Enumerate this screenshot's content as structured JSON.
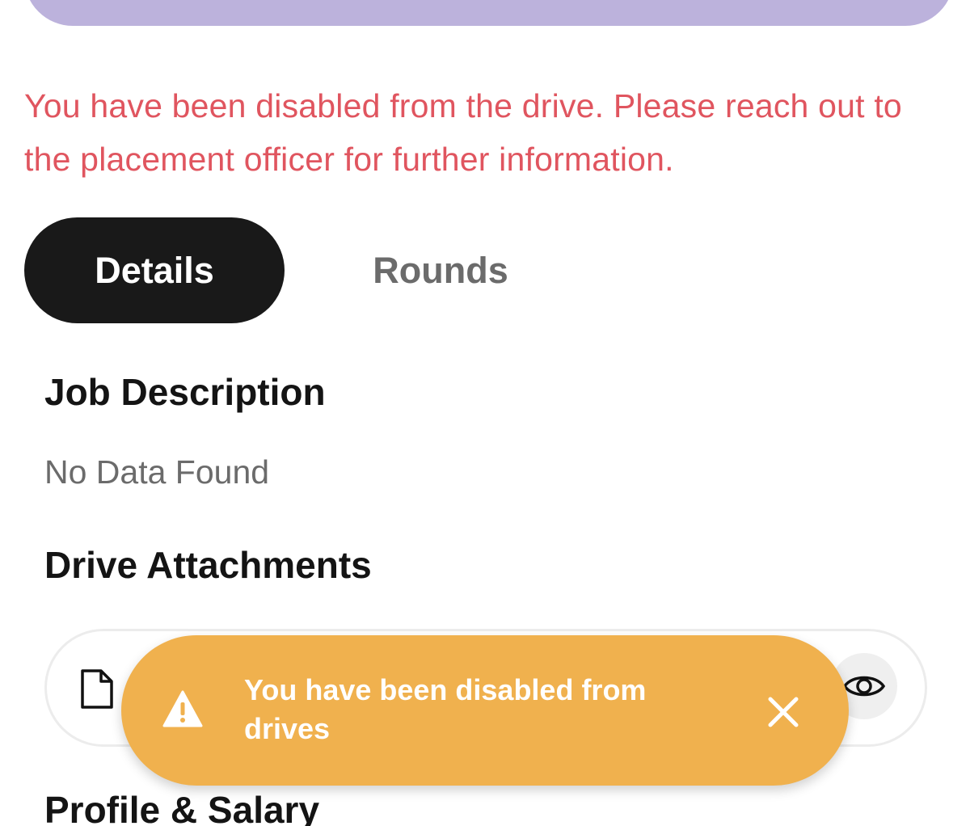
{
  "error_message": "You have been disabled from the drive. Please reach out to the placement officer for further information.",
  "tabs": [
    {
      "label": "Details",
      "active": true
    },
    {
      "label": "Rounds",
      "active": false
    }
  ],
  "job_description": {
    "title": "Job Description",
    "empty_text": "No Data Found"
  },
  "drive_attachments": {
    "title": "Drive Attachments",
    "icons": {
      "file": "file-icon",
      "view": "eye-icon"
    }
  },
  "profile_salary": {
    "title": "Profile & Salary"
  },
  "toast": {
    "message": "You have been disabled from drives",
    "icon": "warning-icon",
    "close_icon": "close-icon"
  },
  "colors": {
    "banner": "#bcb2dc",
    "error_text": "#e0555f",
    "active_tab": "#191919",
    "toast": "#f0b14e"
  }
}
